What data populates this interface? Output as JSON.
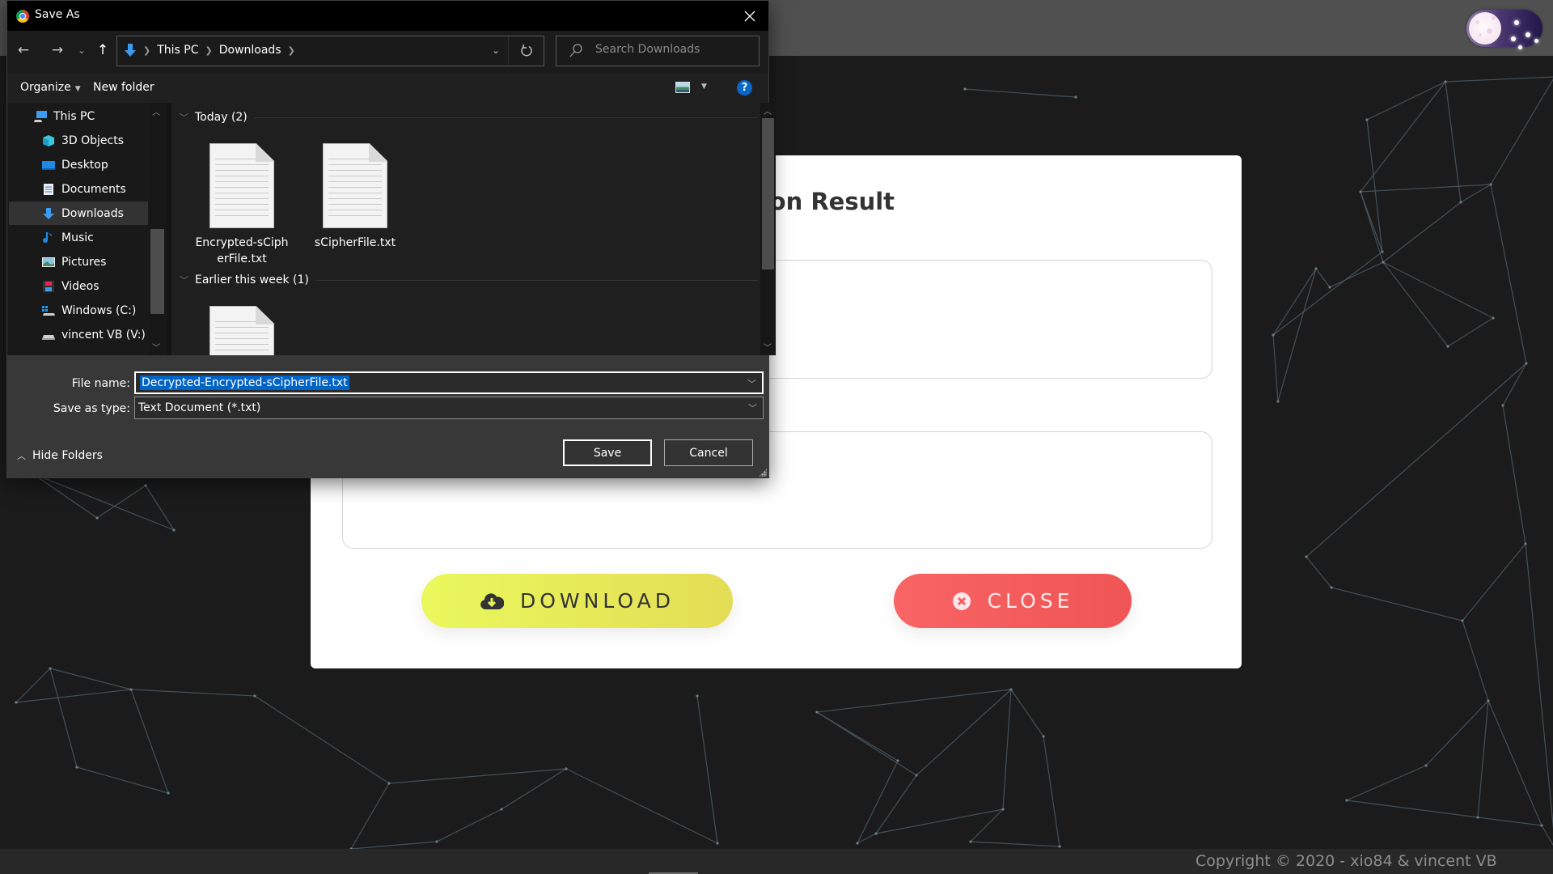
{
  "page": {
    "card_title": "Decryption Result",
    "download_label": "DOWNLOAD",
    "close_label": "CLOSE",
    "footer_text": "Copyright © 2020 - xio84 & vincent VB",
    "theme_toggle_state": "dark",
    "colors": {
      "background": "#1b1b1b",
      "topbar": "#505050",
      "download_button": "#e8f25b",
      "close_button": "#f45c5c"
    }
  },
  "dialog": {
    "title": "Save As",
    "close_glyph": "✕",
    "nav": {
      "back_glyph": "←",
      "forward_glyph": "→",
      "recent_glyph": "⌄",
      "up_glyph": "↑"
    },
    "breadcrumb": [
      "This PC",
      "Downloads"
    ],
    "search_placeholder": "Search Downloads",
    "toolbar": {
      "organize_label": "Organize",
      "new_folder_label": "New folder",
      "help_glyph": "?"
    },
    "sidebar": {
      "items": [
        {
          "label": "This PC",
          "icon": "computer-icon",
          "selected": false
        },
        {
          "label": "3D Objects",
          "icon": "cube-icon",
          "selected": false
        },
        {
          "label": "Desktop",
          "icon": "desktop-icon",
          "selected": false
        },
        {
          "label": "Documents",
          "icon": "documents-icon",
          "selected": false
        },
        {
          "label": "Downloads",
          "icon": "download-arrow-icon",
          "selected": true
        },
        {
          "label": "Music",
          "icon": "music-note-icon",
          "selected": false
        },
        {
          "label": "Pictures",
          "icon": "pictures-icon",
          "selected": false
        },
        {
          "label": "Videos",
          "icon": "videos-icon",
          "selected": false
        },
        {
          "label": "Windows (C:)",
          "icon": "windows-drive-icon",
          "selected": false
        },
        {
          "label": "vincent VB (V:)",
          "icon": "drive-icon",
          "selected": false
        }
      ]
    },
    "groups": [
      {
        "label": "Today (2)",
        "files": [
          "Encrypted-sCipherFile.txt",
          "sCipherFile.txt"
        ]
      },
      {
        "label": "Earlier this week (1)",
        "files": [
          ""
        ]
      }
    ],
    "file_name_label": "File name:",
    "file_name_value": "Decrypted-Encrypted-sCipherFile.txt",
    "save_type_label": "Save as type:",
    "save_type_value": "Text Document (*.txt)",
    "hide_folders_label": "Hide Folders",
    "save_label": "Save",
    "cancel_label": "Cancel"
  }
}
